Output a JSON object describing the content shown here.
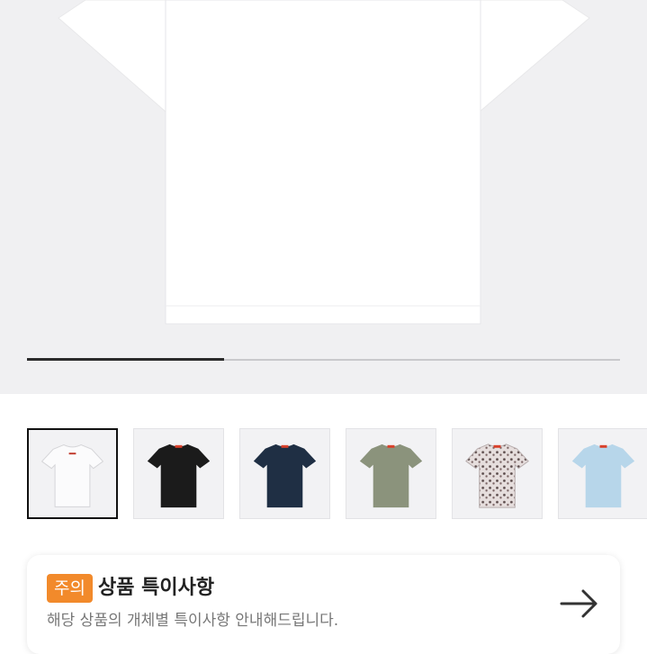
{
  "gallery": {
    "progress_fraction": 0.333,
    "thumbnails": [
      {
        "name": "white",
        "color": "#f7f7f8",
        "selected": true
      },
      {
        "name": "black",
        "color": "#1b1b1b",
        "selected": false
      },
      {
        "name": "navy",
        "color": "#1f2f44",
        "selected": false
      },
      {
        "name": "olive",
        "color": "#8b937c",
        "selected": false
      },
      {
        "name": "pattern",
        "color": "#d7d0d0",
        "selected": false
      },
      {
        "name": "light-blue",
        "color": "#b7d6ea",
        "selected": false
      }
    ]
  },
  "notice": {
    "badge": "주의",
    "title": "상품 특이사항",
    "subtitle": "해당 상품의 개체별 특이사항 안내해드립니다.",
    "arrow_icon": "arrow-right-icon",
    "badge_color": "#f28a2b"
  }
}
